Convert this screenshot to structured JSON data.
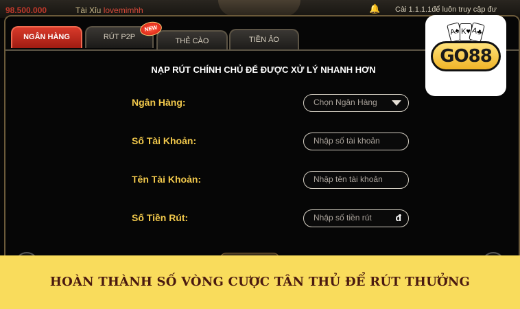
{
  "top": {
    "money": "98.500.000",
    "user_prefix": "Tài Xỉu ",
    "user_name": "lovemimhh",
    "marquee": "Cài 1.1.1.1để luôn truy cập đư",
    "bell_icon": "bell-icon"
  },
  "tabs": [
    {
      "label": "NGÂN HÀNG",
      "active": true
    },
    {
      "label": "RÚT P2P",
      "active": false
    },
    {
      "label": "THẺ CÀO",
      "active": false
    },
    {
      "label": "TIỀN ẢO",
      "active": false
    }
  ],
  "new_badge": "NEW",
  "subtitle": "NẠP RÚT CHÍNH CHỦ ĐỂ ĐƯỢC XỬ LÝ NHANH HƠN",
  "form": {
    "bank_label": "Ngân Hàng:",
    "bank_select": "Chọn Ngân Hàng",
    "account_number_label": "Số Tài Khoản:",
    "account_number_placeholder": "Nhập số tài  khoản",
    "account_name_label": "Tên Tài Khoản:",
    "account_name_placeholder": "Nhập tên tài khoản",
    "amount_label": "Số Tiền Rút:",
    "amount_placeholder": "Nhập số tiền rút",
    "currency_symbol": "đ"
  },
  "logo": {
    "text": "GO88",
    "cards": [
      "A♠",
      "K♥",
      "A♣"
    ]
  },
  "banner": {
    "text": "HOÀN THÀNH SỐ VÒNG CƯỢC TÂN THỦ ĐỂ RÚT THƯỞNG"
  },
  "colors": {
    "accent": "#d83a2a",
    "label": "#f2c94c",
    "banner_bg": "#f9dc5c",
    "banner_text": "#4a1a10"
  }
}
